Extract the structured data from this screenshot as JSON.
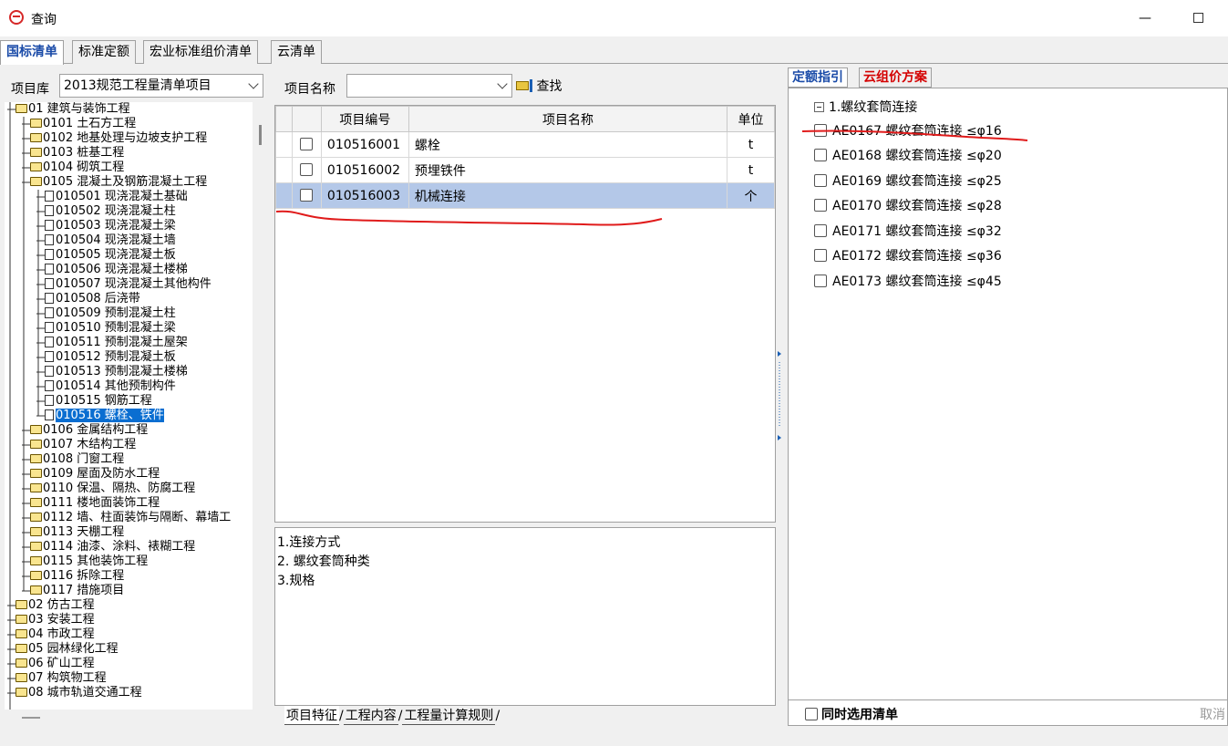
{
  "window": {
    "title": "查询"
  },
  "top_tabs": [
    "国标清单",
    "标准定额",
    "宏业标准组价清单",
    "云清单"
  ],
  "toolbar": {
    "library_label": "项目库",
    "library_value": "2013规范工程量清单项目",
    "name_label": "项目名称",
    "name_value": "",
    "find_label": "查找"
  },
  "tree": {
    "root": "01 建筑与装饰工程",
    "level1a": [
      "0101 土石方工程",
      "0102 地基处理与边坡支护工程",
      "0103 桩基工程",
      "0104 砌筑工程",
      "0105 混凝土及钢筋混凝土工程"
    ],
    "level2": [
      "010501 现浇混凝土基础",
      "010502 现浇混凝土柱",
      "010503 现浇混凝土梁",
      "010504 现浇混凝土墙",
      "010505 现浇混凝土板",
      "010506 现浇混凝土楼梯",
      "010507 现浇混凝土其他构件",
      "010508 后浇带",
      "010509 预制混凝土柱",
      "010510 预制混凝土梁",
      "010511 预制混凝土屋架",
      "010512 预制混凝土板",
      "010513 预制混凝土楼梯",
      "010514 其他预制构件",
      "010515 钢筋工程",
      "010516 螺栓、铁件"
    ],
    "level1b": [
      "0106 金属结构工程",
      "0107 木结构工程",
      "0108 门窗工程",
      "0109 屋面及防水工程",
      "0110 保温、隔热、防腐工程",
      "0111 楼地面装饰工程",
      "0112 墙、柱面装饰与隔断、幕墙工",
      "0113 天棚工程",
      "0114 油漆、涂料、裱糊工程",
      "0115 其他装饰工程",
      "0116 拆除工程",
      "0117 措施项目"
    ],
    "roots": [
      "02 仿古工程",
      "03 安装工程",
      "04 市政工程",
      "05 园林绿化工程",
      "06 矿山工程",
      "07 构筑物工程",
      "08 城市轨道交通工程"
    ]
  },
  "grid": {
    "headers": [
      "项目编号",
      "项目名称",
      "单位"
    ],
    "rows": [
      {
        "code": "010516001",
        "name": "螺栓",
        "unit": "t"
      },
      {
        "code": "010516002",
        "name": "预埋铁件",
        "unit": "t"
      },
      {
        "code": "010516003",
        "name": "机械连接",
        "unit": "个"
      }
    ]
  },
  "description": [
    "1.连接方式",
    "2. 螺纹套筒种类",
    "3.规格"
  ],
  "bottom_tabs": [
    "项目特征",
    "工程内容",
    "工程量计算规则"
  ],
  "right": {
    "tabs": [
      "定额指引",
      "云组价方案"
    ],
    "group": "1.螺纹套筒连接",
    "items": [
      "AE0167 螺纹套筒连接 ≤φ16",
      "AE0168 螺纹套筒连接 ≤φ20",
      "AE0169 螺纹套筒连接 ≤φ25",
      "AE0170 螺纹套筒连接 ≤φ28",
      "AE0171 螺纹套筒连接 ≤φ32",
      "AE0172 螺纹套筒连接 ≤φ36",
      "AE0173 螺纹套筒连接 ≤φ45"
    ],
    "footer_check": "同时选用清单",
    "footer_cancel": "取消"
  },
  "colors": {
    "accent": "#1a4ba8",
    "selection": "#0a6ed1",
    "row_selected": "#b4c8e8",
    "annotation": "#e01b1b"
  }
}
